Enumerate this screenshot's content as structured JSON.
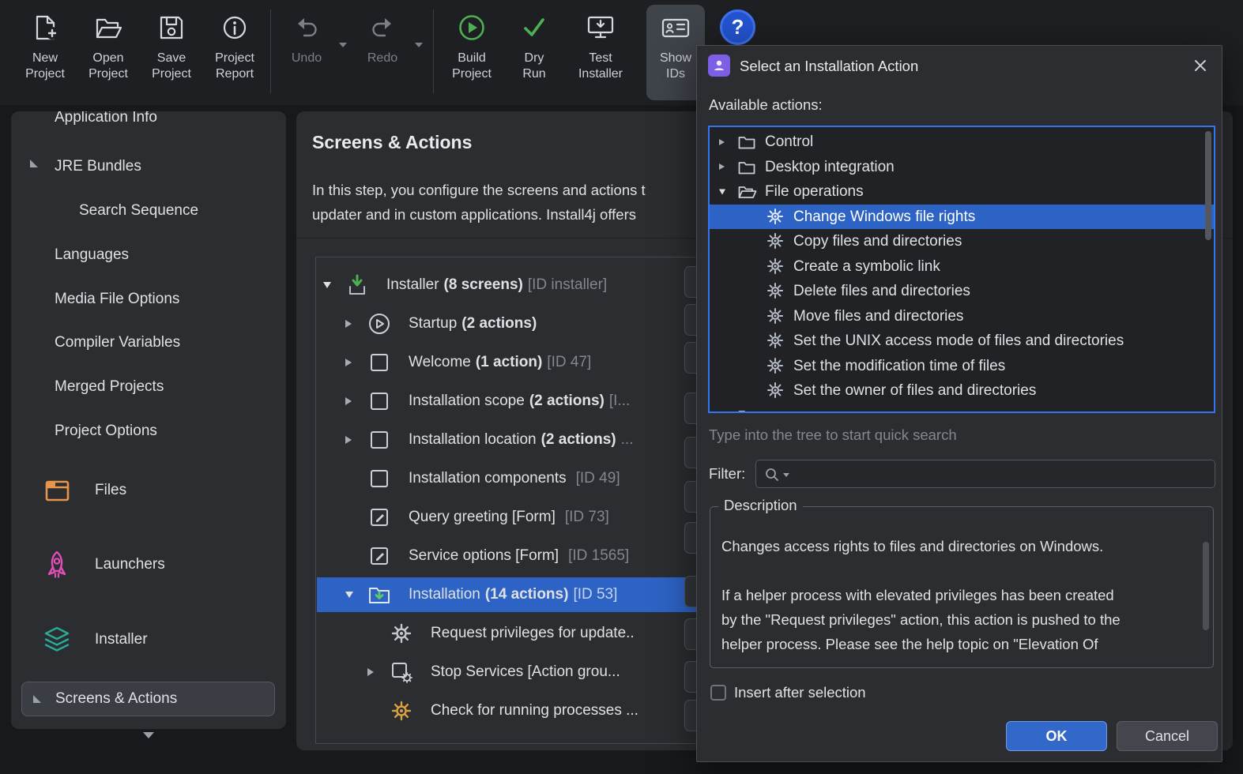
{
  "colors": {
    "selection_blue": "#2d63c5",
    "focus_border": "#3574f0",
    "ok_button": "#3268c9",
    "accent_green": "#4db053",
    "files_orange": "#e8944a",
    "launchers_pink": "#e24fb8",
    "installer_teal": "#2aa898",
    "help_blue": "#2353cf",
    "action_purple": "#7d5fe6"
  },
  "toolbar": {
    "help_glyph": "?",
    "items": [
      {
        "label": "New Project"
      },
      {
        "label": "Open Project"
      },
      {
        "label": "Save Project"
      },
      {
        "label": "Project Report"
      },
      {
        "label": "Undo"
      },
      {
        "label": "Redo"
      },
      {
        "label": "Build Project"
      },
      {
        "label": "Dry Run"
      },
      {
        "label": "Test Installer"
      },
      {
        "label": "Show IDs"
      }
    ]
  },
  "sidebar": {
    "items": [
      {
        "label": "Application Info"
      },
      {
        "label": "JRE Bundles"
      },
      {
        "label": "Search Sequence"
      },
      {
        "label": "Languages"
      },
      {
        "label": "Media File Options"
      },
      {
        "label": "Compiler Variables"
      },
      {
        "label": "Merged Projects"
      },
      {
        "label": "Project Options"
      },
      {
        "label": "Files"
      },
      {
        "label": "Launchers"
      },
      {
        "label": "Installer"
      },
      {
        "label": "Screens & Actions"
      }
    ]
  },
  "main": {
    "title": "Screens & Actions",
    "intro_line1": "In this step, you configure the screens and actions t",
    "intro_line2": "updater and in custom applications. Install4j offers",
    "tree_rows": [
      {
        "label": "Installer",
        "count": "(8 screens)",
        "id": "[ID installer]"
      },
      {
        "label": "Startup",
        "count": "(2 actions)",
        "id": ""
      },
      {
        "label": "Welcome",
        "count": "(1 action)",
        "id": "[ID 47]"
      },
      {
        "label": "Installation scope",
        "count": "(2 actions)",
        "id": "[I..."
      },
      {
        "label": "Installation location",
        "count": "(2 actions)",
        "id": "..."
      },
      {
        "label": "Installation components",
        "count": "",
        "id": "[ID 49]"
      },
      {
        "label": "Query greeting [Form]",
        "count": "",
        "id": "[ID 73]"
      },
      {
        "label": "Service options [Form]",
        "count": "",
        "id": "[ID 1565]"
      },
      {
        "label": "Installation",
        "count": "(14 actions)",
        "id": "[ID 53]"
      },
      {
        "label": "Request privileges for update..",
        "count": "",
        "id": ""
      },
      {
        "label": "Stop Services [Action grou...",
        "count": "",
        "id": ""
      },
      {
        "label": "Check for running processes ...",
        "count": "",
        "id": ""
      }
    ]
  },
  "dialog": {
    "title": "Select an Installation Action",
    "available_actions_label": "Available actions:",
    "tree_rows": [
      {
        "label": "Control"
      },
      {
        "label": "Desktop integration"
      },
      {
        "label": "File operations"
      },
      {
        "label": "Change Windows file rights"
      },
      {
        "label": "Copy files and directories"
      },
      {
        "label": "Create a symbolic link"
      },
      {
        "label": "Delete files and directories"
      },
      {
        "label": "Move files and directories"
      },
      {
        "label": "Set the UNIX access mode of files and directories"
      },
      {
        "label": "Set the modification time of files"
      },
      {
        "label": "Set the owner of files and directories"
      }
    ],
    "quick_search_hint": "Type into the tree to start quick search",
    "filter_label": "Filter:",
    "description_title": "Description",
    "description_lines": [
      "Changes access rights to files and directories on Windows.",
      "",
      "If a helper process with elevated privileges has been created",
      "by the \"Request privileges\" action, this action is pushed to the",
      "helper process. Please see the help topic on \"Elevation Of"
    ],
    "insert_after_selection_label": "Insert after selection",
    "ok_label": "OK",
    "cancel_label": "Cancel"
  }
}
